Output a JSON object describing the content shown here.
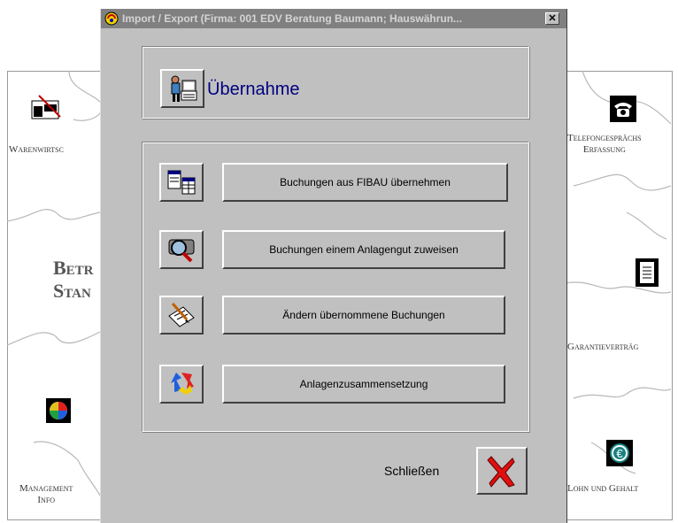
{
  "background": {
    "apps": [
      {
        "label_line1": "Warenwirtsc",
        "label_line2": ""
      },
      {
        "label_line1": "Telefongesprächs",
        "label_line2": "Erfassung"
      },
      {
        "label_line1": "Garantieverträg",
        "label_line2": ""
      },
      {
        "label_line1": "Management",
        "label_line2": "Info"
      },
      {
        "label_line1": "Lohn und Gehalt",
        "label_line2": ""
      }
    ],
    "big_text_line1": "Betr",
    "big_text_line2": "Stan"
  },
  "dialog": {
    "title": "Import / Export  (Firma: 001 EDV Beratung Baumann;  Hauswährun...",
    "close_glyph": "✕",
    "heading": "Übernahme",
    "buttons": [
      {
        "label": "Buchungen aus FIBAU übernehmen",
        "icon": "document-table-icon"
      },
      {
        "label": "Buchungen einem Anlagengut zuweisen",
        "icon": "magnifier-icon"
      },
      {
        "label": "Ändern übernommene Buchungen",
        "icon": "edit-notepad-icon"
      },
      {
        "label": "Anlagenzusammensetzung",
        "icon": "recycle-arrows-icon"
      }
    ],
    "close_label": "Schließen",
    "close_icon": "red-x-icon"
  }
}
